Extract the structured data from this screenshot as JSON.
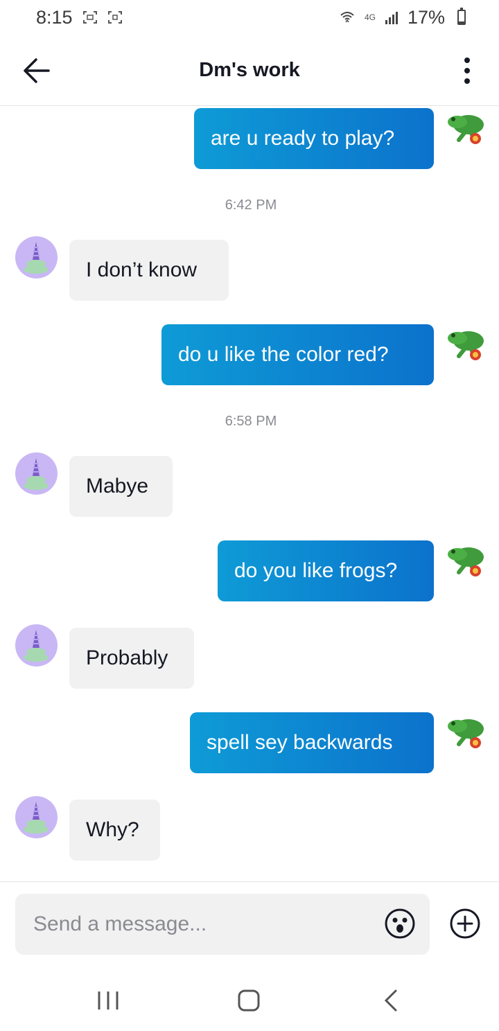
{
  "status_bar": {
    "time": "8:15",
    "network": "4G",
    "battery_text": "17%",
    "battery_level": 0.17
  },
  "header": {
    "title": "Dm's work"
  },
  "messages": [
    {
      "direction": "outgoing",
      "text": "are u ready to play?"
    },
    {
      "type": "timestamp",
      "text": "6:42 PM"
    },
    {
      "direction": "incoming",
      "text": "I don’t know"
    },
    {
      "direction": "outgoing",
      "text": "do u like the color red?"
    },
    {
      "type": "timestamp",
      "text": "6:58 PM"
    },
    {
      "direction": "incoming",
      "text": "Mabye"
    },
    {
      "direction": "outgoing",
      "text": "do you like frogs?"
    },
    {
      "direction": "incoming",
      "text": "Probably"
    },
    {
      "direction": "outgoing",
      "text": "spell sey backwards"
    },
    {
      "direction": "incoming",
      "text": "Why?"
    }
  ],
  "composer": {
    "placeholder": "Send a message..."
  },
  "colors": {
    "outgoing_start": "#0e9bd6",
    "outgoing_end": "#0c72cc",
    "incoming_bg": "#f1f1f2",
    "avatar_in_bg": "#c8b7f4",
    "frog_green": "#3f9b3b"
  },
  "icons": {
    "back": "arrow-left-icon",
    "more": "more-vertical-icon",
    "emoji": "emoji-icon",
    "add": "plus-circle-icon",
    "nav_recents": "recents-icon",
    "nav_home": "home-icon",
    "nav_back": "chevron-left-icon"
  }
}
